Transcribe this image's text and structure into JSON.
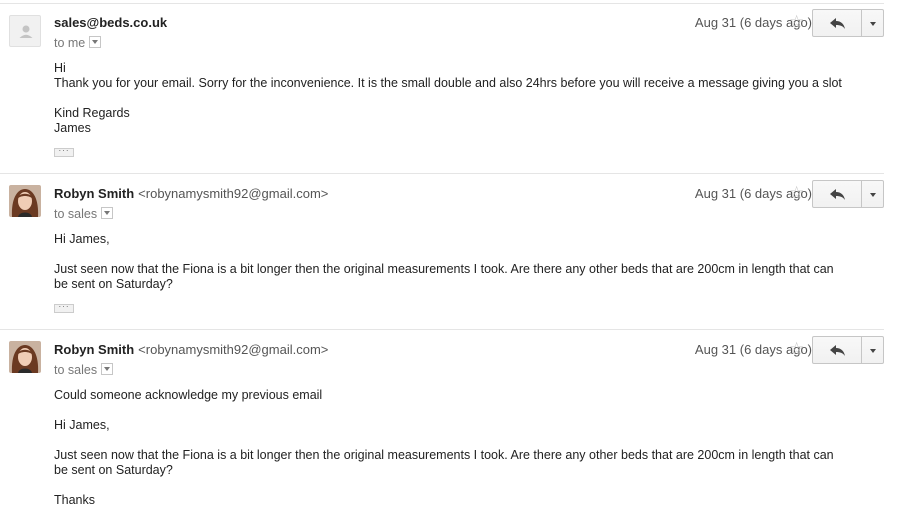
{
  "messages": [
    {
      "sender_name": "sales@beds.co.uk",
      "sender_email": "",
      "recipient": "to me",
      "date": "Aug 31 (6 days ago)",
      "body": [
        "Hi",
        "Thank you for your email. Sorry for the inconvenience. It is the small double and also 24hrs before you will receive a message giving you a slot",
        "Kind Regards",
        "James"
      ],
      "has_trimmed_content": true
    },
    {
      "sender_name": "Robyn Smith",
      "sender_email": "<robynamysmith92@gmail.com>",
      "recipient": "to sales",
      "date": "Aug 31 (6 days ago)",
      "body": [
        "Hi James,",
        "Just seen now that the Fiona is a bit longer then the original measurements I took. Are there any other beds that are 200cm in length that can",
        "be sent on Saturday?"
      ],
      "has_trimmed_content": true
    },
    {
      "sender_name": "Robyn Smith",
      "sender_email": "<robynamysmith92@gmail.com>",
      "recipient": "to sales",
      "date": "Aug 31 (6 days ago)",
      "body": [
        "Could someone acknowledge my previous email",
        "Hi James,",
        "Just seen now that the Fiona is a bit longer then the original measurements I took. Are there any other beds that are 200cm in length that can",
        "be sent on Saturday?",
        "Thanks"
      ],
      "has_trimmed_content": false
    }
  ],
  "icons": {
    "star": "star-icon",
    "reply": "reply-icon",
    "more": "dropdown-arrow-icon",
    "avatar_default": "default-avatar-icon",
    "trimmed": "ellipsis-icon"
  },
  "colors": {
    "text": "#222222",
    "secondary_text": "#555555",
    "divider": "#e5e5e5",
    "button_border": "#c6c6c6"
  }
}
